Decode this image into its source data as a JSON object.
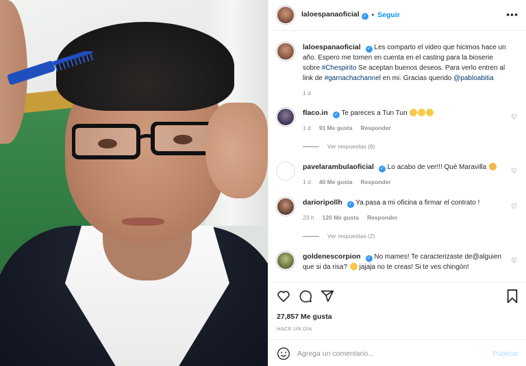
{
  "header": {
    "username": "laloespanaoficial",
    "separator": "•",
    "follow_label": "Seguir",
    "more_icon": "more-horizontal-icon"
  },
  "caption": {
    "username": "laloespanaoficial",
    "text_1": "Les comparto el video que hicimos hace un año. Espero me tomen en cuenta en el casting para la bioserie sobre",
    "hashtag_1": "#Chespirito",
    "text_2": "Se aceptan buenos deseos. Para verlo entren al link de",
    "hashtag_2": "#garnachachannel",
    "text_3": "en mi. Gracias querido",
    "mention": "@pabloabitia",
    "time": "1 d"
  },
  "comments": [
    {
      "username": "flaco.in",
      "text": "Te pareces a Tun Tun",
      "time": "1 d",
      "likes": "91 Me gusta",
      "reply": "Responder",
      "replies": "Ver respuestas (8)"
    },
    {
      "username": "pavelarambulaoficial",
      "text": "Lo acabo de ver!!! Qué Maravilla",
      "time": "1 d",
      "likes": "40 Me gusta",
      "reply": "Responder"
    },
    {
      "username": "darioripollh",
      "text": "Ya pasa a mi oficina a firmar el contrato !",
      "time": "23 h",
      "likes": "120 Me gusta",
      "reply": "Responder",
      "replies": "Ver respuestas (2)"
    },
    {
      "username": "goldenescorpion",
      "text": "No mames! Te caracterizaste de@alguien que si da risa?",
      "text_end": "jajaja no te creas! Si te ves chingón!"
    }
  ],
  "actions": {
    "likes": "27,857 Me gusta",
    "time": "HACE UN DÍA"
  },
  "add_comment": {
    "placeholder": "Agrega un comentario...",
    "publish_label": "Publicar"
  },
  "colors": {
    "link": "#00376b",
    "accent": "#0095f6",
    "verified": "#3897f0",
    "muted": "#8e8e8e"
  }
}
